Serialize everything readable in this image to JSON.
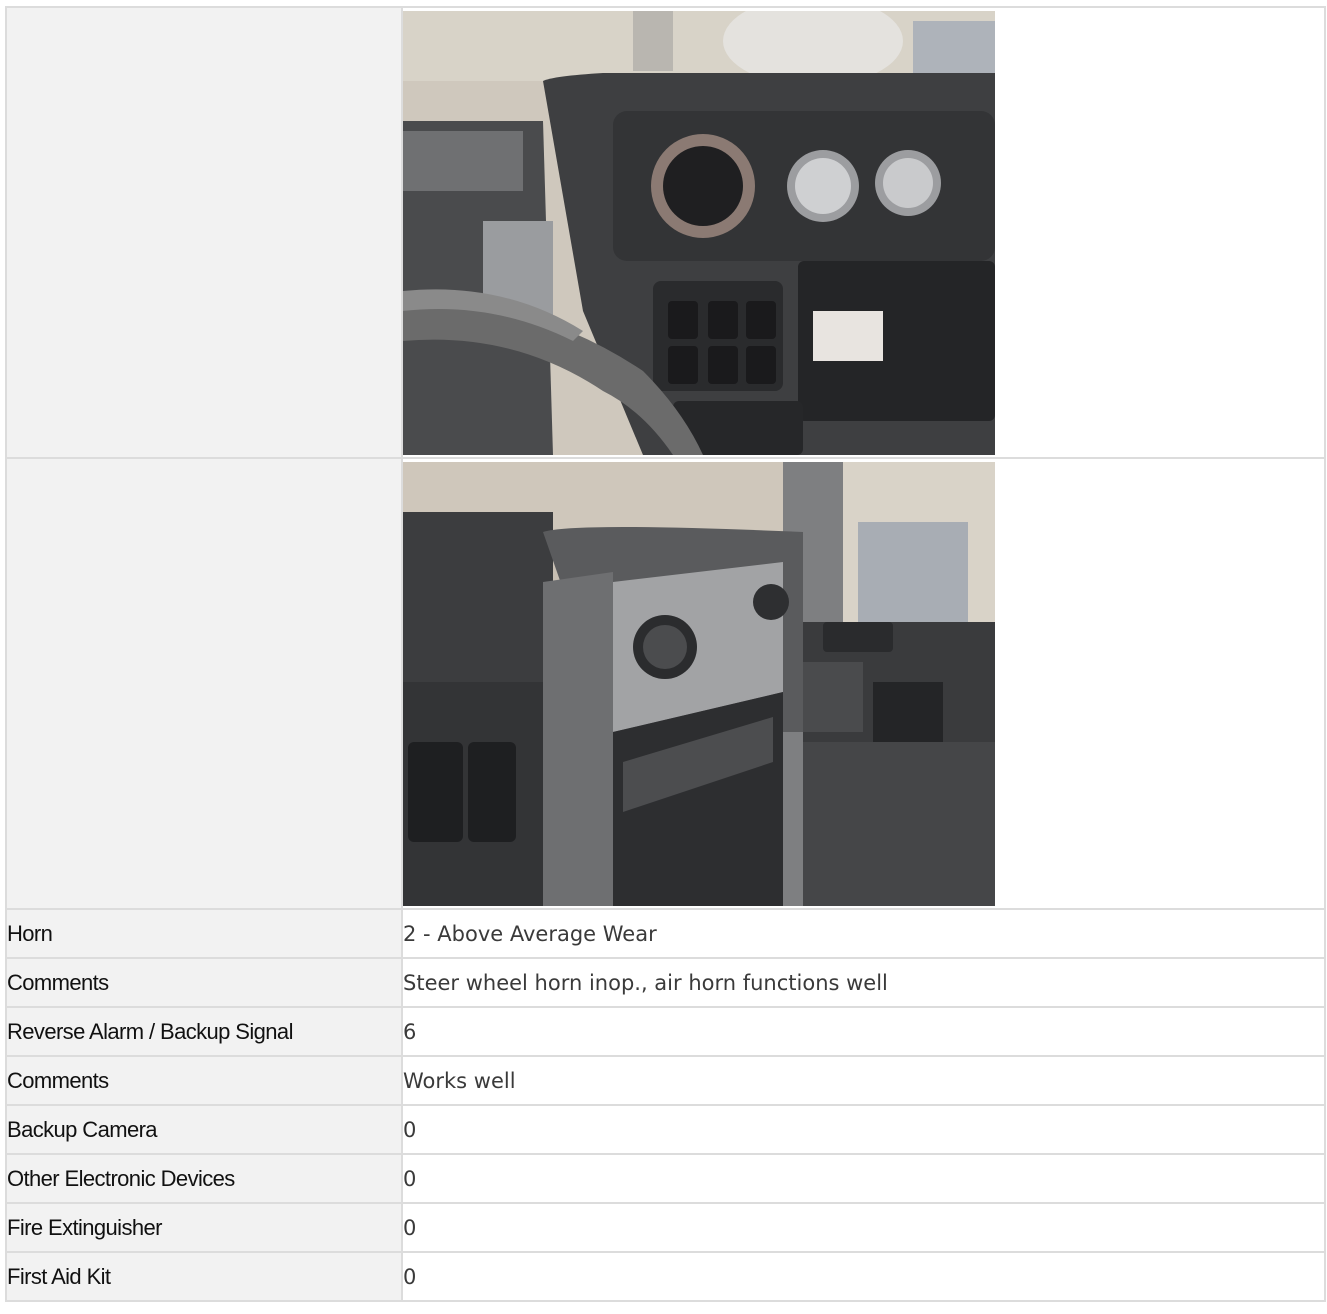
{
  "photos": [
    {
      "icon": "truck-dashboard-photo-icon",
      "colors": {
        "dash": "#3b3c3e",
        "trim": "#8d8e90",
        "sky": "#d8d3c8"
      }
    },
    {
      "icon": "truck-passenger-dash-photo-icon",
      "colors": {
        "dash": "#3a3b3d",
        "trim": "#9b9c9e",
        "sky": "#cfc7bb"
      }
    }
  ],
  "rows": [
    {
      "label": "Horn",
      "value": "2 - Above Average Wear"
    },
    {
      "label": "Comments",
      "value": "Steer wheel horn inop., air horn functions well"
    },
    {
      "label": "Reverse Alarm / Backup Signal",
      "value": "6"
    },
    {
      "label": "Comments",
      "value": "Works well"
    },
    {
      "label": "Backup Camera",
      "value": "0"
    },
    {
      "label": "Other Electronic Devices",
      "value": "0"
    },
    {
      "label": "Fire Extinguisher",
      "value": "0"
    },
    {
      "label": "First Aid Kit",
      "value": "0"
    }
  ]
}
